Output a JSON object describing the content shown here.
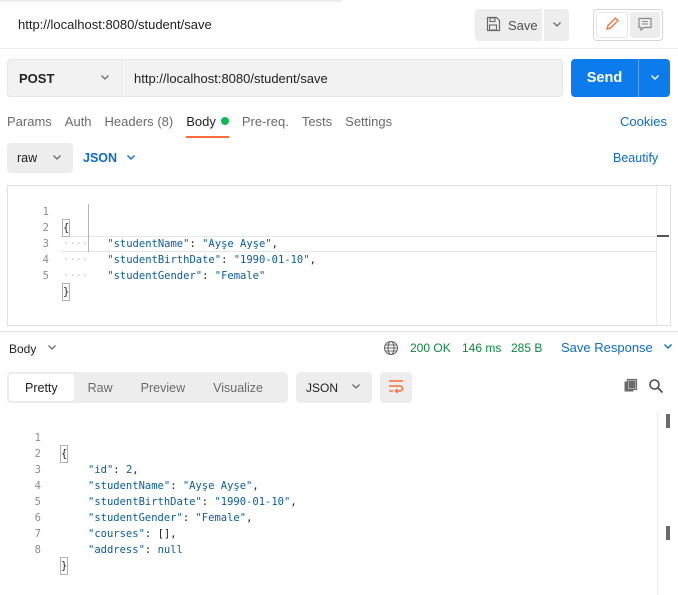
{
  "tab": {
    "title": "http://localhost:8080/student/save"
  },
  "toolbar": {
    "save_label": "Save"
  },
  "request": {
    "method": "POST",
    "url": "http://localhost:8080/student/save",
    "send_label": "Send",
    "tabs": [
      {
        "label": "Params"
      },
      {
        "label": "Auth"
      },
      {
        "label": "Headers",
        "count": "(8)"
      },
      {
        "label": "Body",
        "active": true
      },
      {
        "label": "Pre-req."
      },
      {
        "label": "Tests"
      },
      {
        "label": "Settings"
      }
    ],
    "cookies_label": "Cookies",
    "body_mode": "raw",
    "body_language": "JSON",
    "beautify_label": "Beautify",
    "body_lines": [
      {
        "n": "1",
        "text": "{"
      },
      {
        "n": "2",
        "key": "\"studentName\"",
        "value": "\"Ayşe Ayşe\"",
        "trail": ","
      },
      {
        "n": "3",
        "key": "\"studentBirthDate\"",
        "value": "\"1990-01-10\"",
        "trail": ","
      },
      {
        "n": "4",
        "key": "\"studentGender\"",
        "value": "\"Female\"",
        "trail": ""
      },
      {
        "n": "5",
        "text": "}"
      }
    ]
  },
  "response": {
    "body_label": "Body",
    "status": "200 OK",
    "time": "146 ms",
    "size": "285 B",
    "save_response_label": "Save Response",
    "view_tabs": [
      "Pretty",
      "Raw",
      "Preview",
      "Visualize"
    ],
    "active_view": "Pretty",
    "language": "JSON",
    "lines": [
      {
        "n": "1",
        "text": "{"
      },
      {
        "n": "2",
        "key": "\"id\"",
        "value": "2",
        "trail": ",",
        "vtype": "num"
      },
      {
        "n": "3",
        "key": "\"studentName\"",
        "value": "\"Ayşe Ayşe\"",
        "trail": ",",
        "vtype": "str"
      },
      {
        "n": "4",
        "key": "\"studentBirthDate\"",
        "value": "\"1990-01-10\"",
        "trail": ",",
        "vtype": "str"
      },
      {
        "n": "5",
        "key": "\"studentGender\"",
        "value": "\"Female\"",
        "trail": ",",
        "vtype": "str"
      },
      {
        "n": "6",
        "key": "\"courses\"",
        "value": "[]",
        "trail": ",",
        "vtype": "arr"
      },
      {
        "n": "7",
        "key": "\"address\"",
        "value": "null",
        "trail": "",
        "vtype": "kw"
      },
      {
        "n": "8",
        "text": "}"
      }
    ]
  },
  "icons": {
    "save": "floppy-disk-icon",
    "edit": "pencil-icon",
    "comments": "comment-icon",
    "globe": "globe-icon",
    "wrap": "wrap-lines-icon",
    "copy": "copy-icon",
    "search": "search-icon"
  },
  "colors": {
    "accent": "#ff6c37",
    "send": "#0c7ced",
    "link": "#0c6cc9",
    "success": "#0a8a3c"
  }
}
